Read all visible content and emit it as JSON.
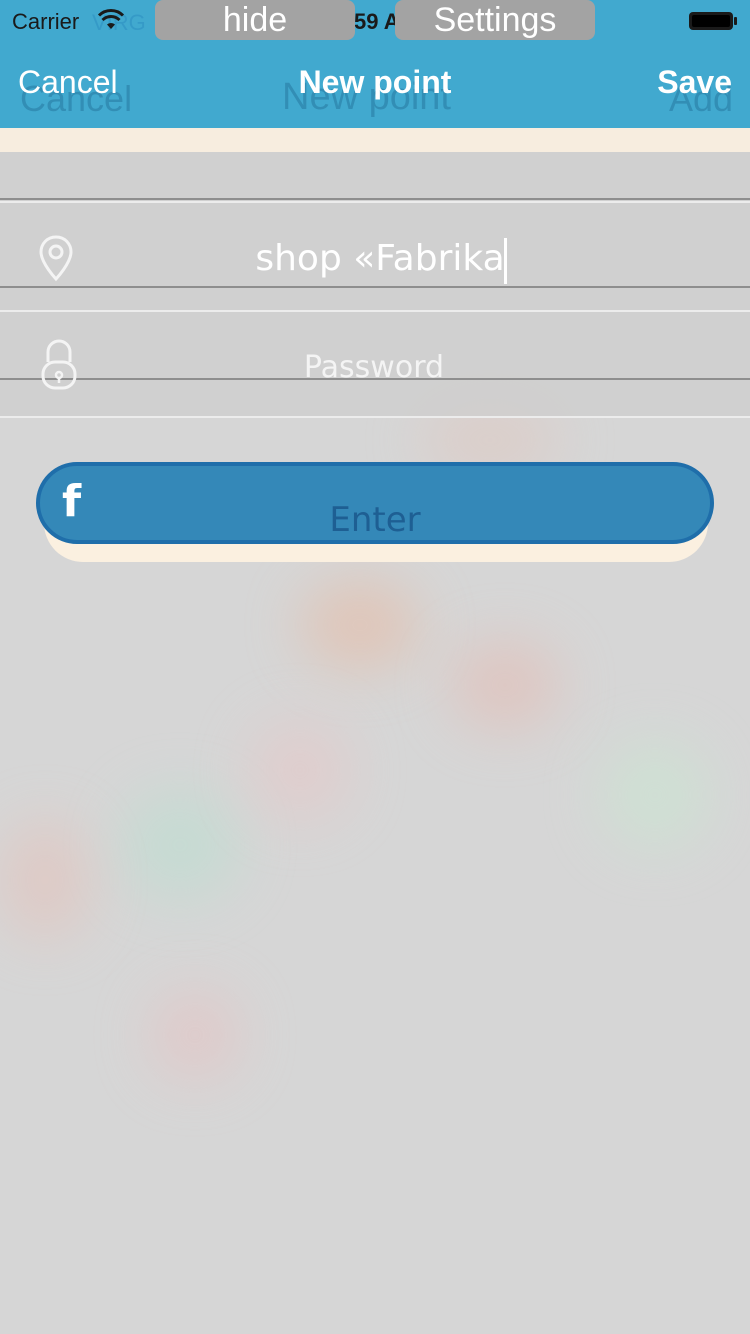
{
  "status_bar": {
    "carrier": "Carrier",
    "ghost_carrier": "VIRG",
    "time": "59 A",
    "overlay_buttons": {
      "hide": "hide",
      "settings": "Settings"
    }
  },
  "nav": {
    "cancel_label": "Cancel",
    "title": "New point",
    "save_label": "Save",
    "ghost": {
      "cancel": "Cancel",
      "title": "New point",
      "add": "Add"
    }
  },
  "form": {
    "location_value": "shop «Fabrika",
    "location_icon": "location-pin-icon",
    "password_placeholder": "Password",
    "password_icon": "lock-icon"
  },
  "enter_button": {
    "label": "Enter",
    "icon": "facebook-icon",
    "icon_glyph": "f"
  },
  "colors": {
    "nav_bar": "#41a9cf",
    "button": "#3488b8",
    "button_border": "#1f6eaa",
    "highlight_strip": "#fbf0e0",
    "background": "#d6d6d6"
  }
}
